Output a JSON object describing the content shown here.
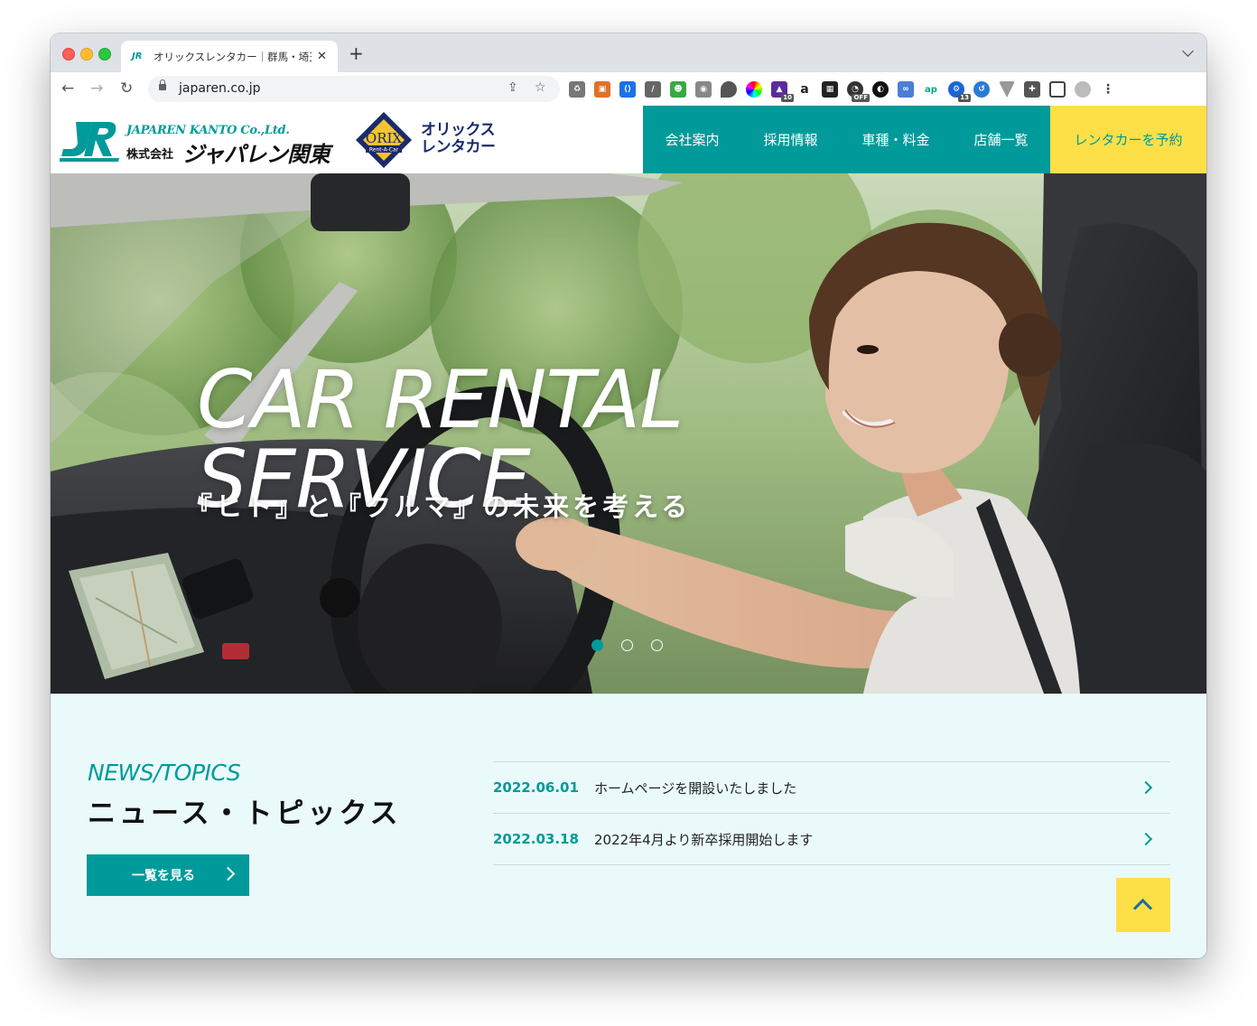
{
  "browser": {
    "tab_title": "オリックスレンタカー｜群馬・埼玉",
    "tab_close": "✕",
    "new_tab": "+",
    "url": "japaren.co.jp",
    "ext_badges": {
      "ext1": "10",
      "ext2": "OFF",
      "ext3": "13"
    }
  },
  "header": {
    "logo_en": "JAPAREN KANTO Co.,Ltd.",
    "logo_jp_small": "株式会社",
    "logo_jp_big": "ジャパレン関東",
    "orix_name": "ORIX",
    "orix_sub": "Rent-A-Car",
    "orix_line1": "オリックス",
    "orix_line2": "レンタカー",
    "nav": [
      "会社案内",
      "採用情報",
      "車種・料金",
      "店舗一覧"
    ],
    "reserve": "レンタカーを予約"
  },
  "hero": {
    "title_line1": "CAR RENTAL",
    "title_line2": "SERVICE",
    "subtitle": "『ヒト』と『クルマ』の未来を考える",
    "slide_count": 3,
    "active_slide": 1
  },
  "news": {
    "heading_en": "NEWS/TOPICS",
    "heading_jp": "ニュース・トピックス",
    "more_label": "一覧を見る",
    "items": [
      {
        "date": "2022.06.01",
        "title": "ホームページを開設いたしました"
      },
      {
        "date": "2022.03.18",
        "title": "2022年4月より新卒採用開始します"
      }
    ]
  },
  "colors": {
    "teal": "#009a9a",
    "yellow": "#fde047",
    "navy": "#1a2a6c"
  }
}
